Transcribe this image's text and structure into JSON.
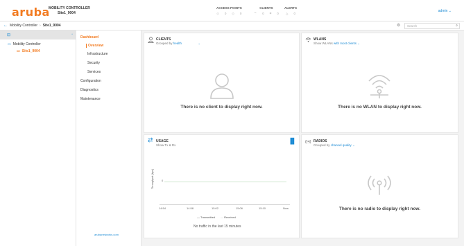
{
  "header": {
    "logo": "aruba",
    "product": "MOBILITY CONTROLLER",
    "site": "Site1_9004",
    "stats": [
      {
        "label": "ACCESS POINTS",
        "values": [
          "0",
          "0"
        ]
      },
      {
        "label": "CLIENTS",
        "values": [
          "0",
          "0"
        ]
      },
      {
        "label": "ALERTS",
        "values": [
          "0",
          "0"
        ]
      }
    ],
    "user": "admin"
  },
  "breadcrumb": {
    "root": "Mobility Controller",
    "current": "Site1_9004"
  },
  "search": {
    "placeholder": "Search"
  },
  "tree": {
    "root": "Mobility Controller",
    "child": "Site1_9004"
  },
  "nav": {
    "dashboard": "Dashboard",
    "overview": "Overview",
    "infrastructure": "Infrastructure",
    "security": "Security",
    "services": "Services",
    "configuration": "Configuration",
    "diagnostics": "Diagnostics",
    "maintenance": "Maintenance",
    "footer": "arubanetworks.com"
  },
  "clients": {
    "title": "CLIENTS",
    "subtitle_prefix": "Grouped by",
    "group_by": "health",
    "empty": "There is no client to display right now."
  },
  "wlans": {
    "title": "WLANS",
    "subtitle_prefix": "Show WLANs",
    "mode": "with most clients",
    "empty": "There is no WLAN to display right now."
  },
  "usage": {
    "title": "USAGE",
    "subtitle": "Show Tx & Rx",
    "ylabel": "Throughput (bps)",
    "ytick": "0",
    "xticks": [
      "14:54",
      "14:58",
      "15:02",
      "15:06",
      "15:10",
      "Now"
    ],
    "legend": [
      "Transmitted",
      "Received"
    ],
    "empty": "No traffic in the last 15 minutes"
  },
  "radios": {
    "title": "RADIOS",
    "subtitle_prefix": "Grouped by",
    "group_by": "channel quality",
    "empty": "There is no radio to display right now."
  },
  "colors": {
    "accent": "#f27b21",
    "link": "#1a8ad4"
  }
}
